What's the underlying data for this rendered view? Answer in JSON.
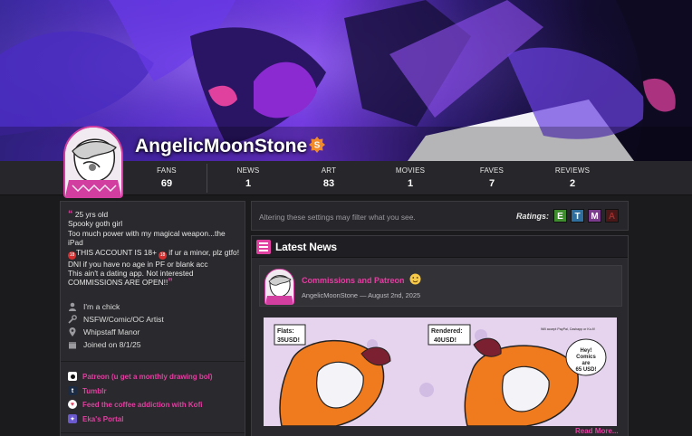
{
  "profile": {
    "username": "AngelicMoonStone",
    "supporter_badge": "S"
  },
  "stats": [
    {
      "label": "FANS",
      "value": "69"
    },
    {
      "label": "NEWS",
      "value": "1"
    },
    {
      "label": "ART",
      "value": "83"
    },
    {
      "label": "MOVIES",
      "value": "1"
    },
    {
      "label": "FAVES",
      "value": "7"
    },
    {
      "label": "REVIEWS",
      "value": "2"
    }
  ],
  "bio": {
    "line1": "25 yrs old",
    "line2": "Spooky goth girl",
    "line3": "Too much power with my magical weapon...the iPad",
    "line4": "THIS ACCOUNT IS 18+",
    "line4b": " if ur a minor, plz gtfo! DNI if you have no age in PF or blank acc",
    "line5": "This ain't a dating app. Not interested",
    "line6": "COMMISSIONS ARE OPEN!!",
    "age_badge": "18",
    "open_quote": "“",
    "close_quote": "”"
  },
  "info": [
    {
      "icon": "user-icon",
      "text": "I'm a chick"
    },
    {
      "icon": "wrench-icon",
      "text": "NSFW/Comic/OC Artist"
    },
    {
      "icon": "location-pin-icon",
      "text": "Whipstaff Manor"
    },
    {
      "icon": "calendar-icon",
      "text": "Joined on 8/1/25"
    }
  ],
  "links": [
    {
      "icon": "patreon-icon",
      "text": "Patreon (u get a monthly drawing bol)"
    },
    {
      "icon": "tumblr-icon",
      "text": "Tumblr"
    },
    {
      "icon": "kofi-icon",
      "text": "Feed the coffee addiction with Kofi"
    },
    {
      "icon": "portal-icon",
      "text": "Eka's Portal"
    }
  ],
  "filter": {
    "notice": "Altering these settings may filter what you see.",
    "ratings_label": "Ratings:",
    "ratings": [
      {
        "letter": "E",
        "color": "#3e8c2e"
      },
      {
        "letter": "T",
        "color": "#2f6fa0"
      },
      {
        "letter": "M",
        "color": "#7b3b8c"
      },
      {
        "letter": "A",
        "color": "#8a2424"
      }
    ]
  },
  "news": {
    "title": "Latest News",
    "post": {
      "title": "Commissions and Patreon",
      "meta": "AngelicMoonStone — August 2nd, 2025",
      "read_more": "Read More...",
      "art_labels": {
        "flats": "Flats:",
        "flats_price": "35USD!",
        "rendered": "Rendered:",
        "rendered_price": "40USD!",
        "accept": "Will accept PayPal, Cashapp or Ko-fi!",
        "bubble1": "Hey!",
        "bubble2": "Comics",
        "bubble3": "are",
        "bubble4": "65 USD!"
      }
    }
  },
  "colors": {
    "accent": "#e040a0",
    "panel": "#2a292d",
    "background": "#1b1b1d"
  }
}
